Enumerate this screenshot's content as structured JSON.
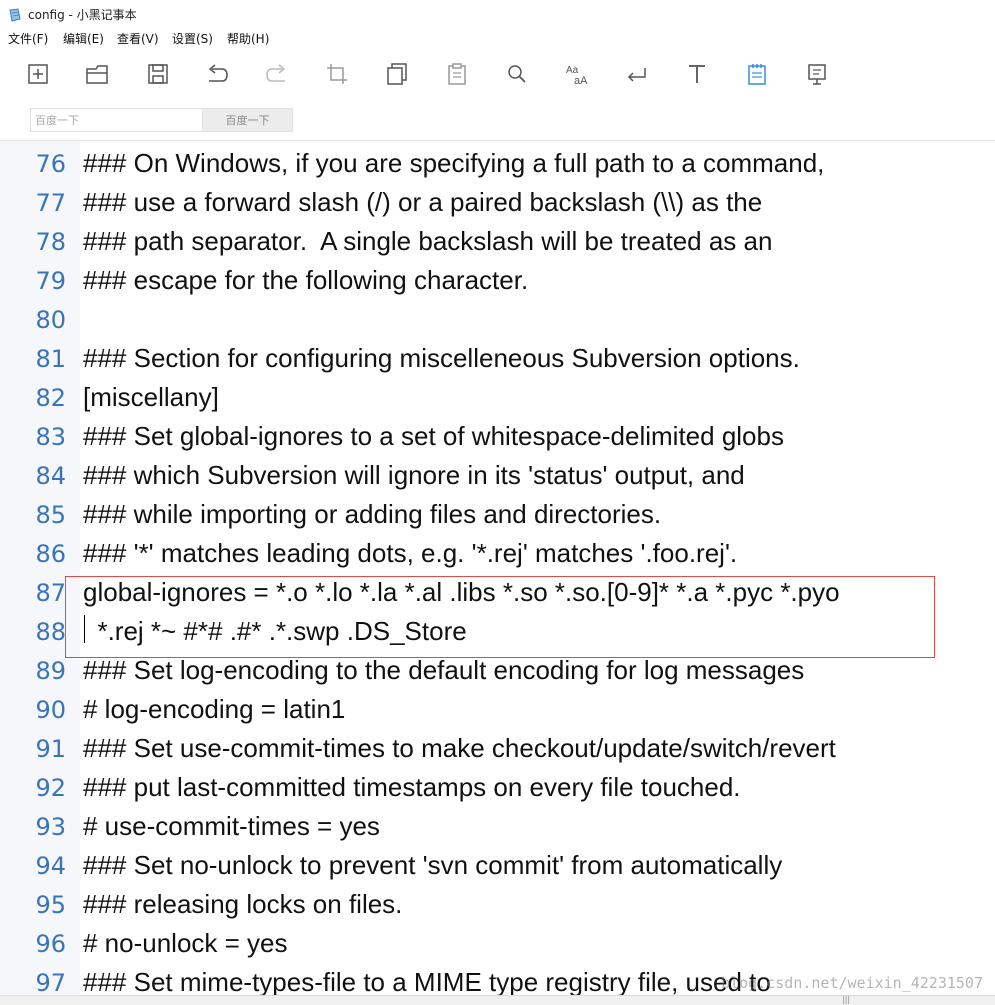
{
  "window": {
    "title": "config - 小黑记事本"
  },
  "menu": [
    {
      "label": "文件(F)"
    },
    {
      "label": "编辑(E)"
    },
    {
      "label": "查看(V)"
    },
    {
      "label": "设置(S)"
    },
    {
      "label": "帮助(H)"
    }
  ],
  "toolbar": {
    "icons": [
      "new-file-icon",
      "open-file-icon",
      "save-icon",
      "undo-icon",
      "redo-icon",
      "crop-icon",
      "copy-icon",
      "paste-icon",
      "search-icon",
      "font-size-icon",
      "line-break-icon",
      "text-icon",
      "notepad-icon",
      "display-icon"
    ]
  },
  "search": {
    "placeholder": "百度一下",
    "button_label": "百度一下"
  },
  "editor": {
    "lines": [
      {
        "num": "76",
        "text": "### On Windows, if you are specifying a full path to a command,"
      },
      {
        "num": "77",
        "text": "### use a forward slash (/) or a paired backslash (\\\\) as the"
      },
      {
        "num": "78",
        "text": "### path separator.  A single backslash will be treated as an"
      },
      {
        "num": "79",
        "text": "### escape for the following character."
      },
      {
        "num": "80",
        "text": ""
      },
      {
        "num": "81",
        "text": "### Section for configuring miscelleneous Subversion options."
      },
      {
        "num": "82",
        "text": "[miscellany]"
      },
      {
        "num": "83",
        "text": "### Set global-ignores to a set of whitespace-delimited globs"
      },
      {
        "num": "84",
        "text": "### which Subversion will ignore in its 'status' output, and"
      },
      {
        "num": "85",
        "text": "### while importing or adding files and directories."
      },
      {
        "num": "86",
        "text": "### '*' matches leading dots, e.g. '*.rej' matches '.foo.rej'."
      },
      {
        "num": "87",
        "text": "global-ignores = *.o *.lo *.la *.al .libs *.so *.so.[0-9]* *.a *.pyc *.pyo"
      },
      {
        "num": "88",
        "text": "  *.rej *~ #*# .#* .*.swp .DS_Store"
      },
      {
        "num": "89",
        "text": "### Set log-encoding to the default encoding for log messages"
      },
      {
        "num": "90",
        "text": "# log-encoding = latin1"
      },
      {
        "num": "91",
        "text": "### Set use-commit-times to make checkout/update/switch/revert"
      },
      {
        "num": "92",
        "text": "### put last-committed timestamps on every file touched."
      },
      {
        "num": "93",
        "text": "# use-commit-times = yes"
      },
      {
        "num": "94",
        "text": "### Set no-unlock to prevent 'svn commit' from automatically"
      },
      {
        "num": "95",
        "text": "### releasing locks on files."
      },
      {
        "num": "96",
        "text": "# no-unlock = yes"
      },
      {
        "num": "97",
        "text": "### Set mime-types-file to a MIME type registry file, used to"
      }
    ]
  },
  "watermark": "blog.csdn.net/weixin_42231507",
  "colors": {
    "line_number": "#3a74b8",
    "highlight_border": "#e04a4a",
    "gutter_bg": "#f5f7fa",
    "active_icon": "#2f8ee6"
  }
}
